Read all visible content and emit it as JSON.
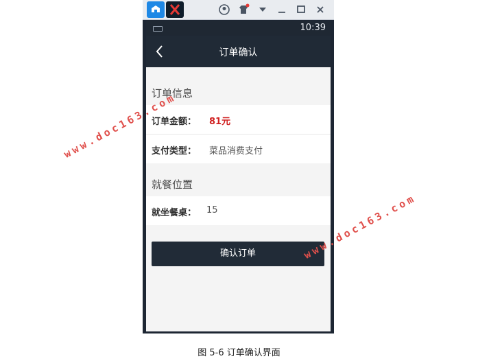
{
  "statusbar": {
    "time": "10:39"
  },
  "navbar": {
    "title": "订单确认",
    "back_icon": "chevron-left-icon"
  },
  "order_info": {
    "title": "订单信息",
    "amount_label": "订单金额：",
    "amount_value": "81元",
    "pay_type_label": "支付类型：",
    "pay_type_value": "菜品消费支付"
  },
  "dining_position": {
    "title": "就餐位置",
    "table_label": "就坐餐桌：",
    "table_value": "15"
  },
  "confirm_button": {
    "label": "确认订单"
  },
  "watermarks": [
    "www.doc163.com",
    "www.doc163.com"
  ],
  "caption": "图 5-6    订单确认界面",
  "colors": {
    "navbar": "#202a36",
    "amount": "#d02020",
    "button": "#212b37"
  }
}
